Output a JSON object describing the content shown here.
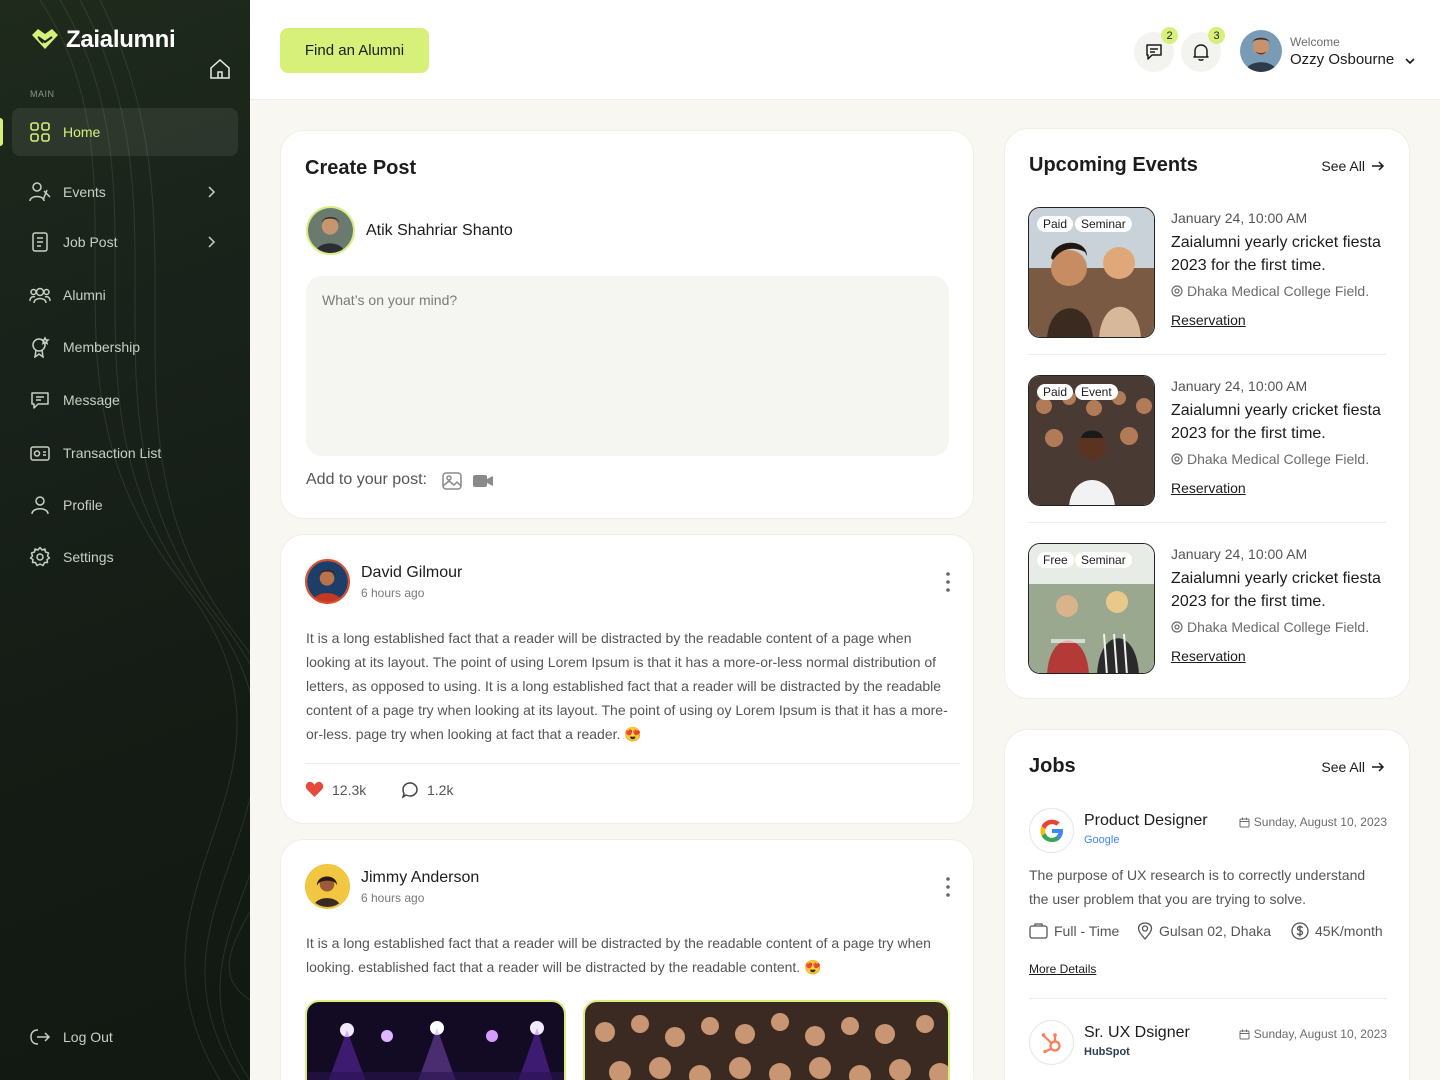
{
  "brand": {
    "name": "Zaialumni",
    "accent": "#d6f07a",
    "sidebar_bg": "#1a231a"
  },
  "sidebar": {
    "section_label": "MAIN",
    "items": [
      {
        "label": "Home",
        "icon": "grid-icon",
        "active": true
      },
      {
        "label": "Events",
        "icon": "events-icon",
        "has_submenu": true
      },
      {
        "label": "Job Post",
        "icon": "document-icon",
        "has_submenu": true
      },
      {
        "label": "Alumni",
        "icon": "users-icon"
      },
      {
        "label": "Membership",
        "icon": "badge-icon"
      },
      {
        "label": "Message",
        "icon": "message-icon"
      },
      {
        "label": "Transaction List",
        "icon": "wallet-icon"
      },
      {
        "label": "Profile",
        "icon": "user-icon"
      },
      {
        "label": "Settings",
        "icon": "gear-icon"
      }
    ],
    "logout_label": "Log Out"
  },
  "header": {
    "find_button": "Find an Alumni",
    "messages_count": "2",
    "notifications_count": "3",
    "welcome": "Welcome",
    "user_name": "Ozzy Osbourne"
  },
  "create_post": {
    "title": "Create Post",
    "author": "Atik Shahriar Shanto",
    "placeholder": "What’s on your mind?",
    "add_label": "Add to your post:"
  },
  "posts": [
    {
      "author": "David Gilmour",
      "time": "6 hours ago",
      "body": "It is a long established fact that a reader will be distracted by the readable content of a page when looking at its layout. The point of using Lorem Ipsum is that it has a more-or-less normal distribution of letters, as opposed to using. It is a long established fact that a reader will be distracted by the readable content of a page try when looking at its layout. The point of using oy Lorem Ipsum is that it has a more-or-less. page try when looking at fact that a reader. 😍",
      "likes": "12.3k",
      "comments": "1.2k"
    },
    {
      "author": "Jimmy Anderson",
      "time": "6 hours ago",
      "body": "It is a long established fact that a reader will be distracted by the readable content of a page try when looking. established fact that a reader will be distracted by the readable content. 😍"
    }
  ],
  "events": {
    "title": "Upcoming Events",
    "see_all": "See All",
    "items": [
      {
        "tags": [
          "Paid",
          "Seminar"
        ],
        "date": "January 24, 10:00 AM",
        "title": "Zaialumni yearly cricket fiesta 2023 for the first time.",
        "location": "Dhaka Medical College Field.",
        "link": "Reservation"
      },
      {
        "tags": [
          "Paid",
          "Event"
        ],
        "date": "January 24, 10:00 AM",
        "title": "Zaialumni yearly cricket fiesta 2023 for the first time.",
        "location": "Dhaka Medical College Field.",
        "link": "Reservation"
      },
      {
        "tags": [
          "Free",
          "Seminar"
        ],
        "date": "January 24, 10:00 AM",
        "title": "Zaialumni yearly cricket fiesta 2023 for the first time.",
        "location": "Dhaka Medical College Field.",
        "link": "Reservation"
      }
    ]
  },
  "jobs": {
    "title": "Jobs",
    "see_all": "See All",
    "items": [
      {
        "title": "Product Designer",
        "company": "Google",
        "date": "Sunday, August 10, 2023",
        "description": "The purpose of UX research is to correctly understand the user problem that you are trying to solve.",
        "type": "Full - Time",
        "location": "Gulsan 02, Dhaka",
        "salary": "45K/month",
        "more": "More Details"
      },
      {
        "title": "Sr. UX Dsigner",
        "company": "HubSpot",
        "date": "Sunday, August 10, 2023"
      }
    ]
  }
}
